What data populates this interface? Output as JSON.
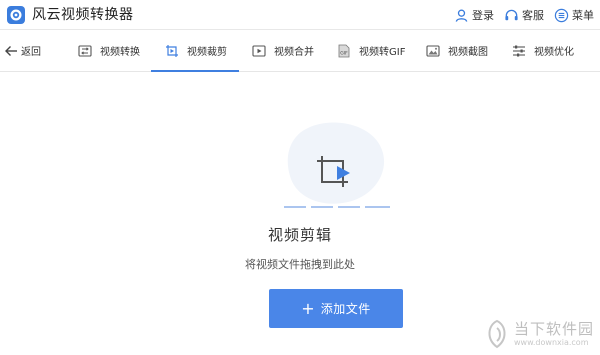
{
  "app": {
    "title": "风云视频转换器"
  },
  "titlebar": {
    "login": "登录",
    "service": "客服",
    "menu": "菜单"
  },
  "nav": {
    "back": "返回",
    "items": [
      {
        "label": "视频转换",
        "icon": "video-convert-icon"
      },
      {
        "label": "视频裁剪",
        "icon": "video-crop-icon",
        "active": true
      },
      {
        "label": "视频合并",
        "icon": "video-merge-icon"
      },
      {
        "label": "视频转GIF",
        "icon": "gif-icon"
      },
      {
        "label": "视频截图",
        "icon": "screenshot-icon"
      },
      {
        "label": "视频优化",
        "icon": "optimize-icon"
      }
    ]
  },
  "main": {
    "title": "视频剪辑",
    "subtitle": "将视频文件拖拽到此处",
    "add_button": "添加文件"
  },
  "watermark": {
    "text": "当下软件园",
    "url": "www.downxia.com"
  },
  "colors": {
    "accent": "#4a86e8",
    "active_underline": "#3f7fe0"
  }
}
